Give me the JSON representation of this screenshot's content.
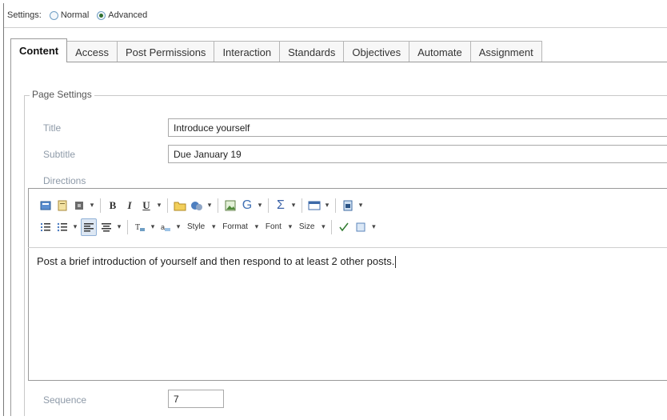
{
  "settings": {
    "label": "Settings:",
    "options": [
      {
        "label": "Normal",
        "selected": false
      },
      {
        "label": "Advanced",
        "selected": true
      }
    ]
  },
  "tabs": [
    {
      "label": "Content",
      "active": true
    },
    {
      "label": "Access",
      "active": false
    },
    {
      "label": "Post Permissions",
      "active": false
    },
    {
      "label": "Interaction",
      "active": false
    },
    {
      "label": "Standards",
      "active": false
    },
    {
      "label": "Objectives",
      "active": false
    },
    {
      "label": "Automate",
      "active": false
    },
    {
      "label": "Assignment",
      "active": false
    }
  ],
  "page_settings": {
    "legend": "Page Settings",
    "title_label": "Title",
    "title_value": "Introduce yourself",
    "subtitle_label": "Subtitle",
    "subtitle_value": "Due January 19",
    "directions_label": "Directions",
    "sequence_label": "Sequence",
    "sequence_value": "7"
  },
  "toolbar": {
    "bold": "B",
    "italic": "I",
    "underline": "U",
    "style_label": "Style",
    "format_label": "Format",
    "font_label": "Font",
    "size_label": "Size",
    "drop_arrow": "▾"
  },
  "editor": {
    "content": "Post a brief introduction of yourself and then respond to at least 2 other posts."
  },
  "colors": {
    "label_gray": "#8e9aa8",
    "active_tab_border": "#9a9a9a",
    "radio_blue": "#6f9ec4"
  }
}
